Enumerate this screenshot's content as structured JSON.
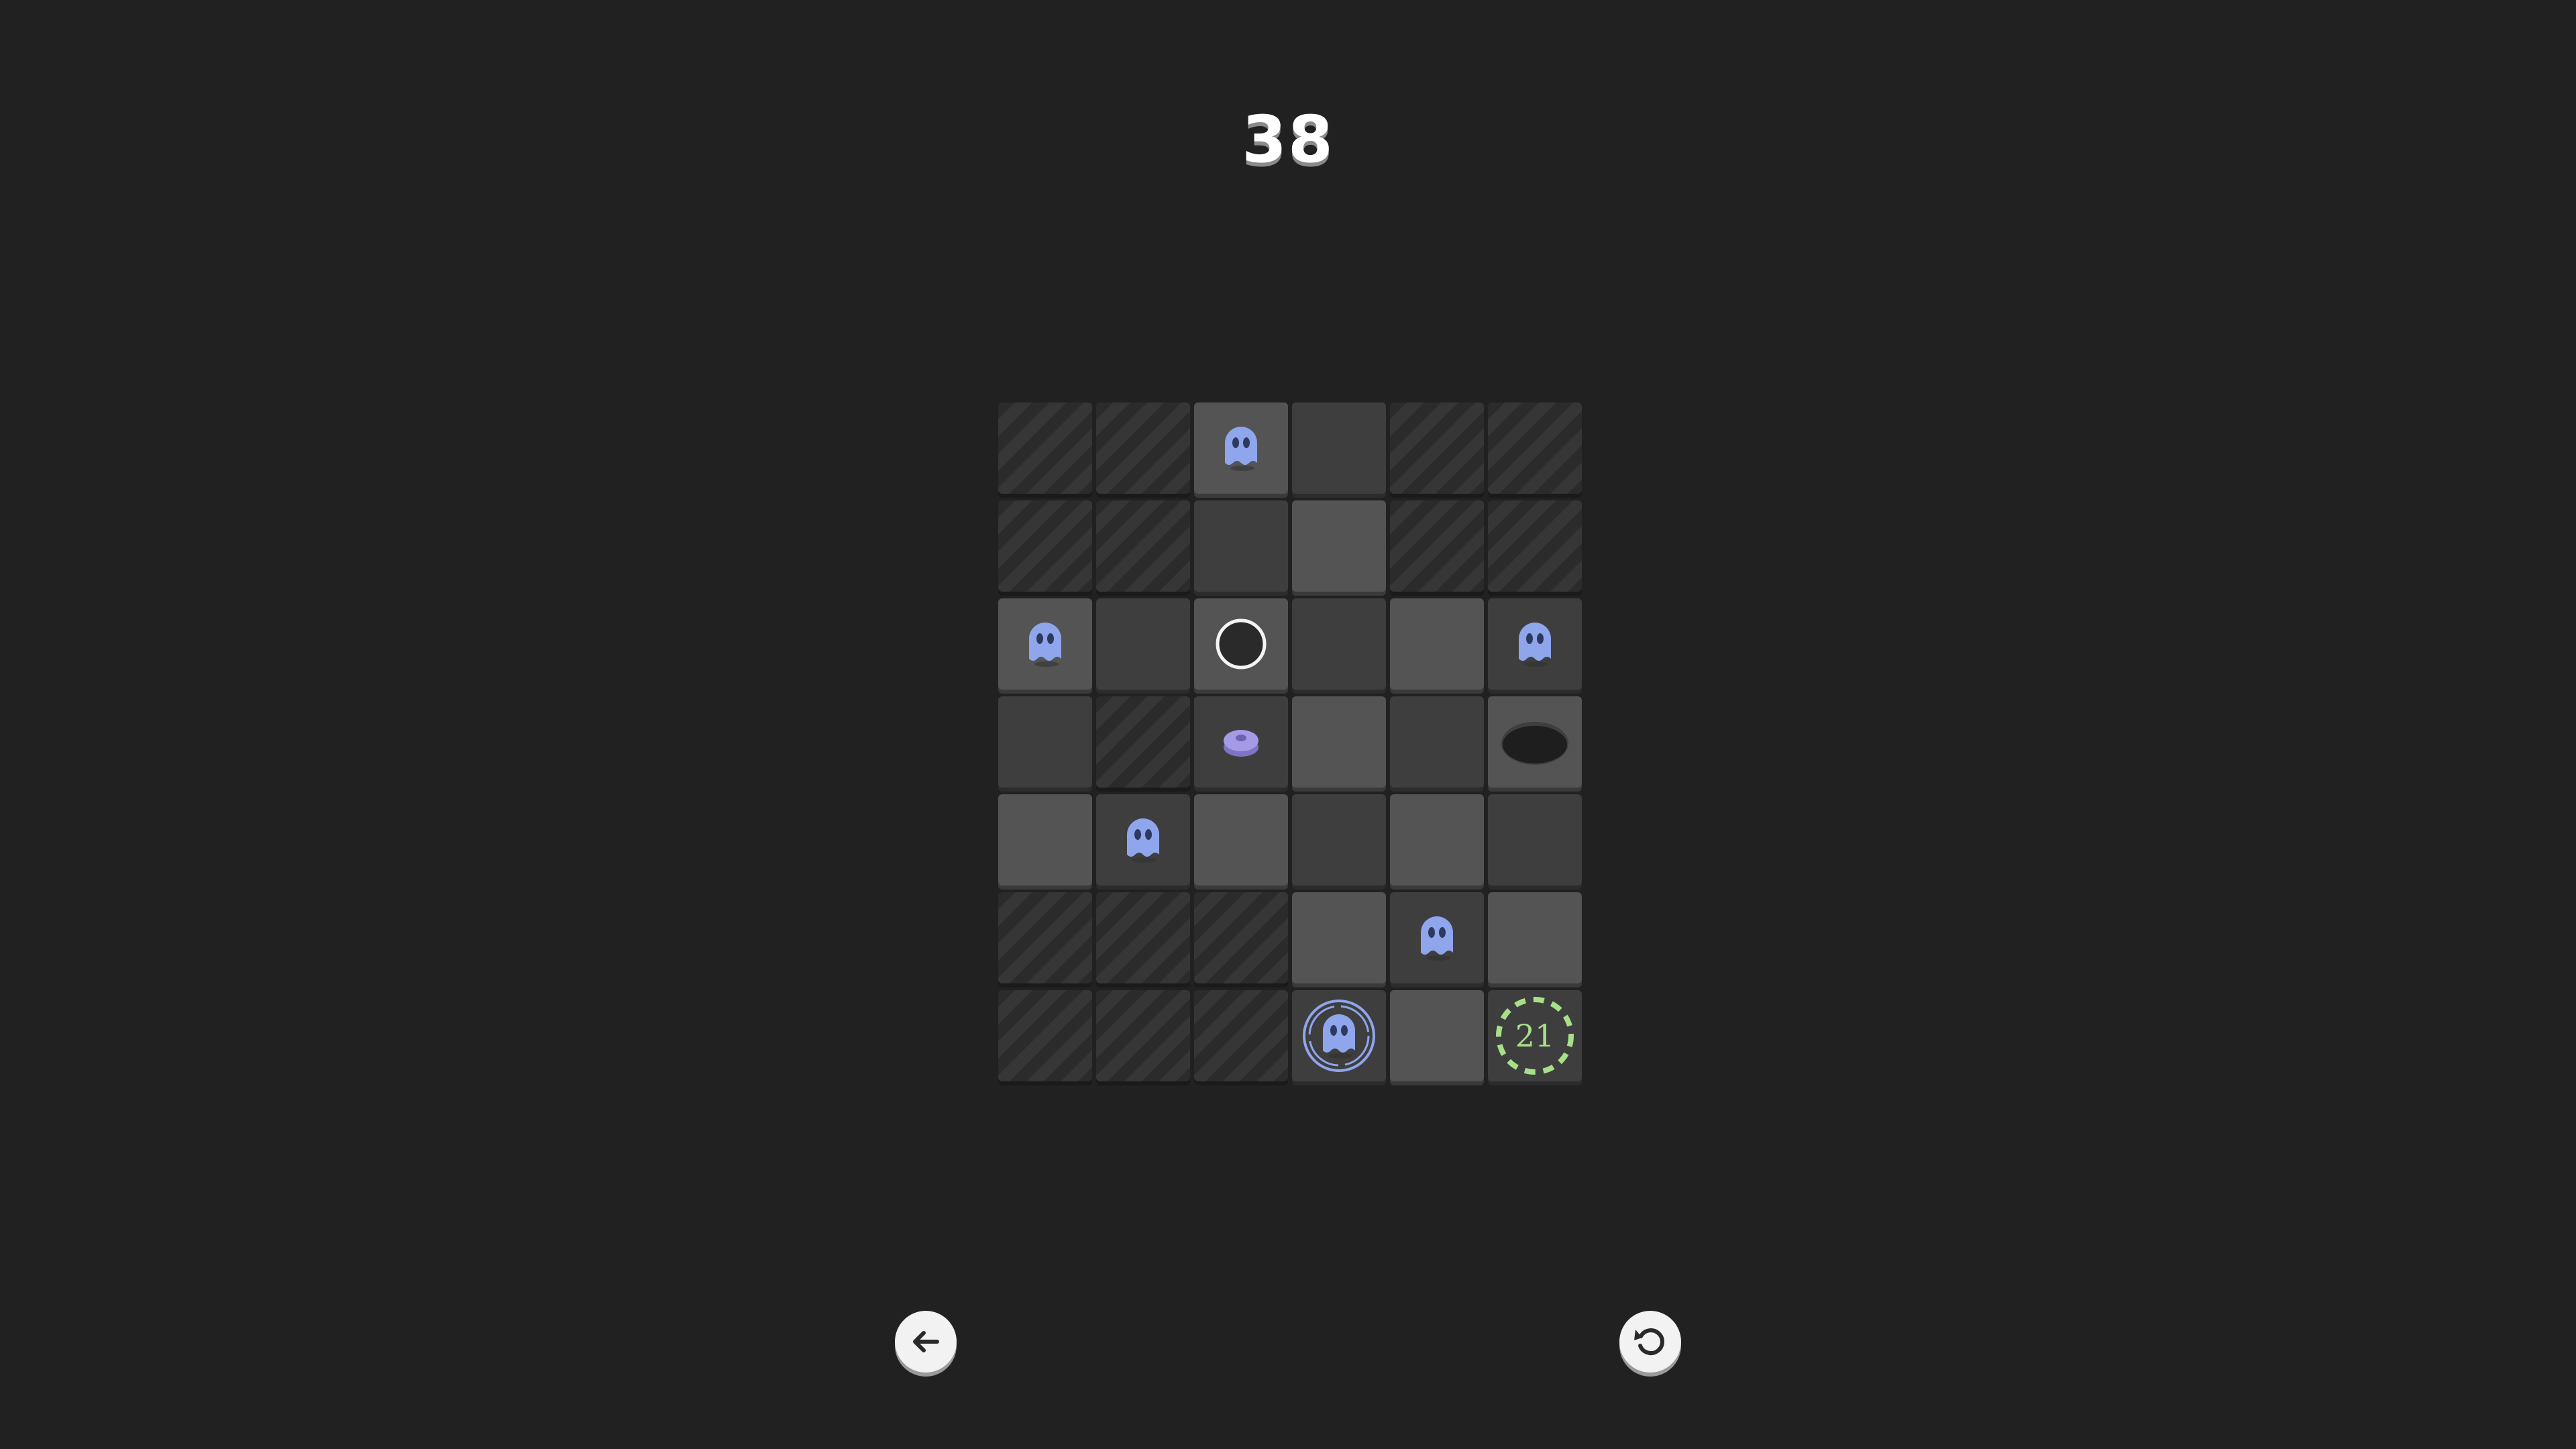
{
  "level": {
    "number": "38"
  },
  "grid": {
    "rows": 7,
    "cols": 6
  },
  "exit": {
    "label": "21",
    "color": "#a8e08a"
  },
  "colors": {
    "ghost": "#8fa5ec",
    "ghost_eye": "#2d3a5e",
    "player_ring": "#8fa5ec",
    "gem": "#a59ae6",
    "background": "#212121"
  },
  "icons": {
    "ghost": "ghost-icon",
    "player": "player-ghost-icon",
    "target": "empty-circle-icon",
    "gem": "gem-icon",
    "hole": "hole-icon",
    "exit": "exit-portal-icon",
    "back": "back-arrow-icon",
    "restart": "restart-icon"
  },
  "controls": {
    "back": {
      "icon": "back-arrow-icon"
    },
    "restart": {
      "icon": "restart-icon"
    }
  }
}
